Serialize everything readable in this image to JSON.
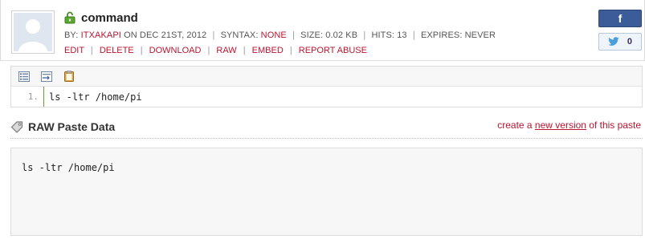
{
  "paste": {
    "title": "command",
    "info": {
      "by_label": "BY:",
      "author": "ITXAKAPI",
      "date": "ON DEC 21ST, 2012",
      "syntax_label": "SYNTAX:",
      "syntax": "NONE",
      "size": "SIZE: 0.02 KB",
      "hits": "HITS: 13",
      "expires": "EXPIRES: NEVER"
    },
    "actions": {
      "edit": "EDIT",
      "delete": "DELETE",
      "download": "DOWNLOAD",
      "raw": "RAW",
      "embed": "EMBED",
      "report": "REPORT ABUSE"
    }
  },
  "social": {
    "facebook_label": "f",
    "tweet_count": "0"
  },
  "code": {
    "line_number": "1.",
    "line_text": "ls -ltr /home/pi"
  },
  "raw": {
    "title": "RAW Paste Data",
    "create_prefix": "create a ",
    "new_version_link": "new version",
    "create_suffix": " of this paste",
    "content": "ls -ltr /home/pi"
  },
  "colors": {
    "accent_red": "#b8152f",
    "facebook_blue": "#3b5b99",
    "line_green": "#6a9a3a"
  }
}
